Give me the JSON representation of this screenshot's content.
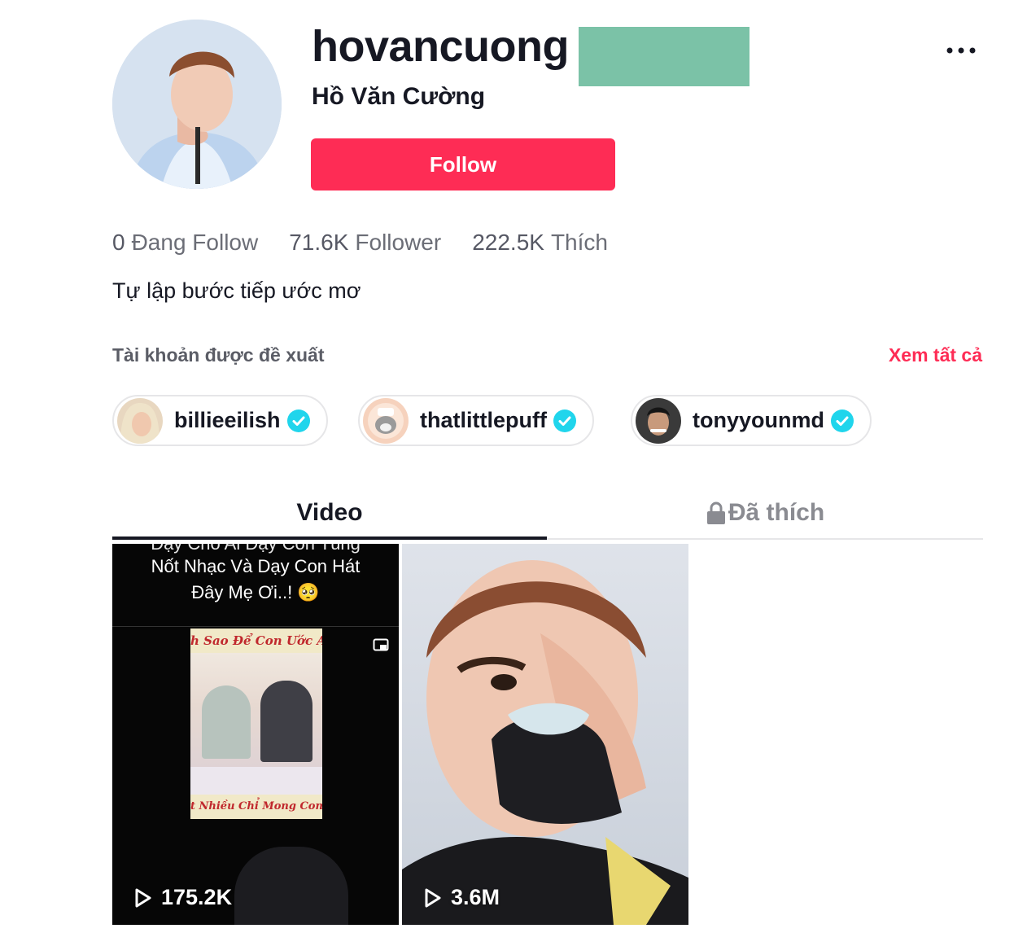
{
  "profile": {
    "username": "hovancuong",
    "nickname": "Hồ Văn Cường",
    "follow_label": "Follow",
    "bio": "Tự lập bước tiếp ước mơ"
  },
  "stats": [
    {
      "value": "0",
      "label": "Đang Follow"
    },
    {
      "value": "71.6K",
      "label": "Follower"
    },
    {
      "value": "222.5K",
      "label": "Thích"
    }
  ],
  "suggested": {
    "title": "Tài khoản được đề xuất",
    "see_all": "Xem tất cả",
    "accounts": [
      {
        "name": "billieeilish"
      },
      {
        "name": "thatlittlepuff"
      },
      {
        "name": "tonyyounmd"
      }
    ]
  },
  "tabs": {
    "video": "Video",
    "liked": "Đã thích"
  },
  "videos": [
    {
      "caption_line1": "Nốt Nhạc Và Dạy Con Hát",
      "caption_line2": "Đây Mẹ Ơi..! 🥺",
      "banner_top": "h Sao Để Con Ước Ao",
      "banner_bottom": "t Nhiều Chỉ Mong Con Yê",
      "views": "175.2K"
    },
    {
      "views": "3.6M"
    }
  ],
  "colors": {
    "accent": "#fe2c55",
    "verified": "#20d5ec",
    "text": "#161823"
  }
}
